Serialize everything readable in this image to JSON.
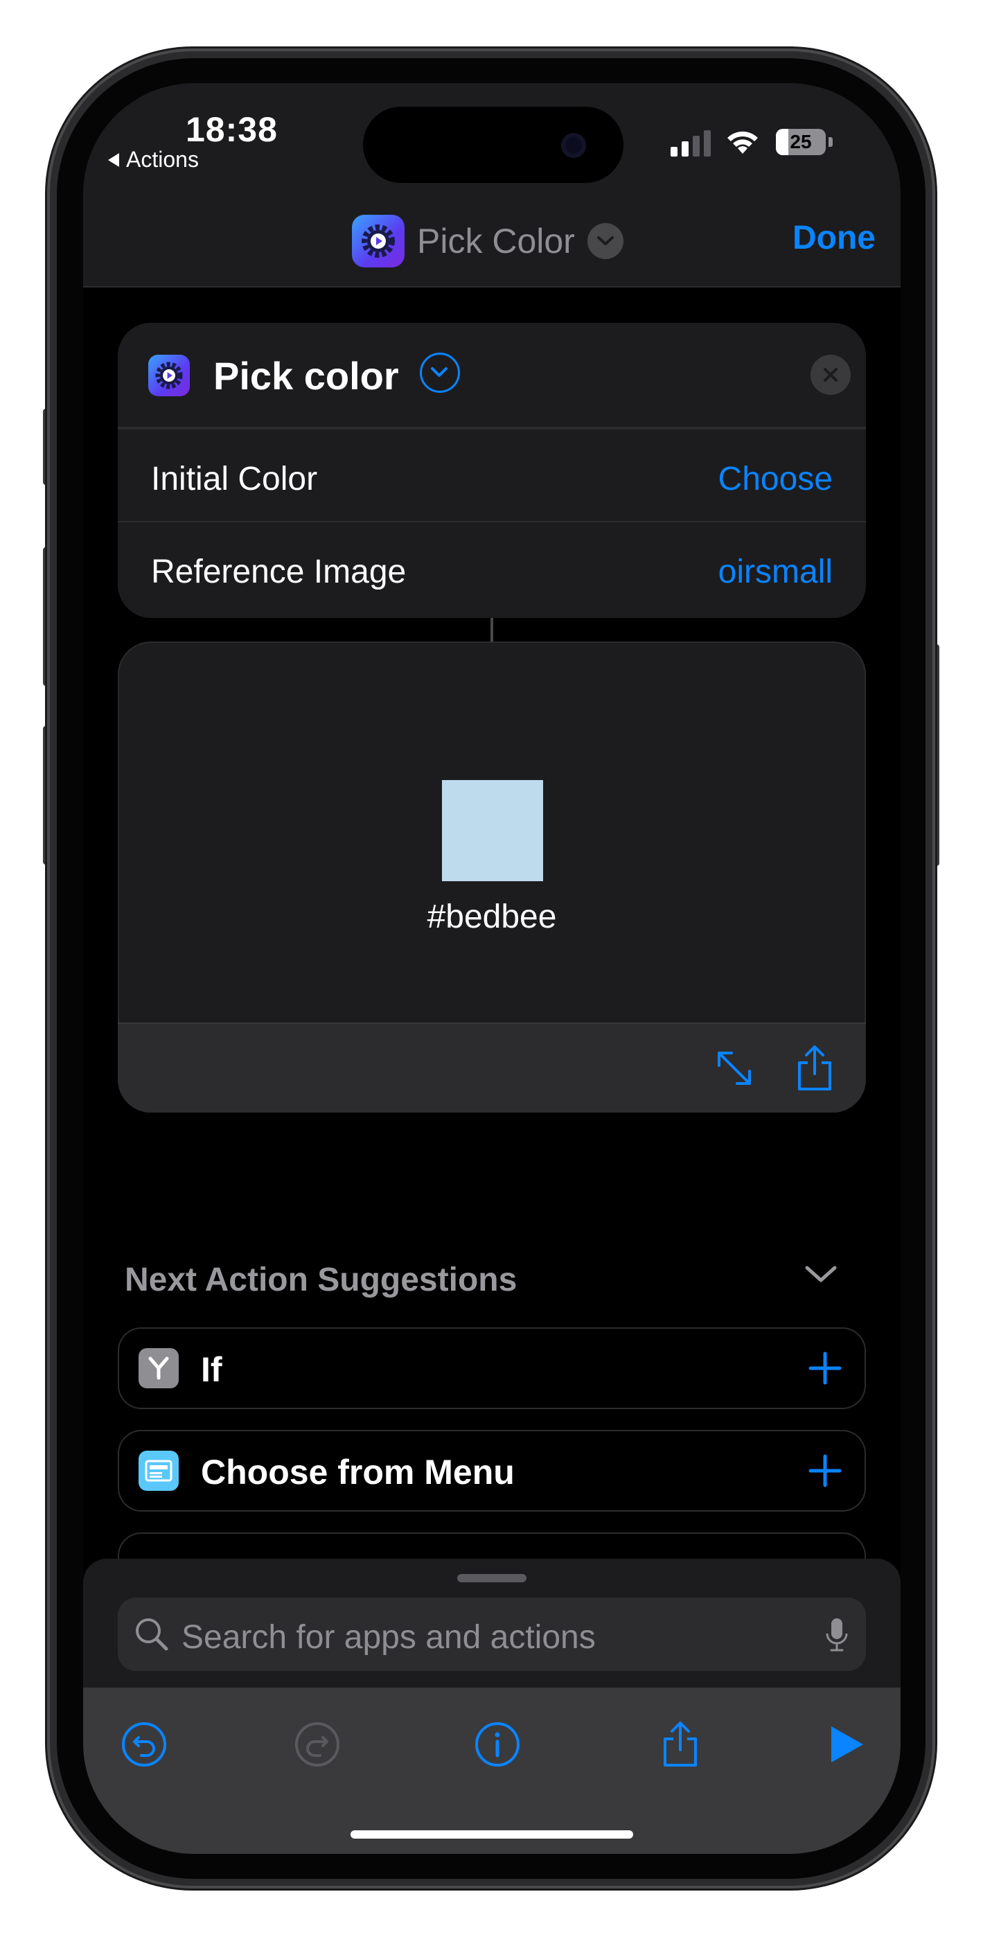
{
  "status_bar": {
    "time": "18:38",
    "back_label": "Actions",
    "battery_level": "25",
    "battery_fraction": 0.25
  },
  "nav": {
    "title": "Pick Color",
    "done_label": "Done",
    "app_icon": "shortcuts-action-icon"
  },
  "action_card": {
    "title": "Pick color",
    "rows": [
      {
        "label": "Initial Color",
        "value": "Choose"
      },
      {
        "label": "Reference Image",
        "value": "oirsmall"
      }
    ]
  },
  "result": {
    "swatch_color": "#bedbee",
    "hex_label": "#bedbee"
  },
  "suggestions": {
    "title": "Next Action Suggestions",
    "items": [
      {
        "label": "If",
        "icon": "branch-icon",
        "icon_color": "#8e8e93"
      },
      {
        "label": "Choose from Menu",
        "icon": "menu-icon",
        "icon_color": "#5ac8fa"
      }
    ]
  },
  "search": {
    "placeholder": "Search for apps and actions"
  },
  "colors": {
    "accent": "#0a84ff",
    "background": "#000000",
    "surface": "#1c1c1e"
  }
}
